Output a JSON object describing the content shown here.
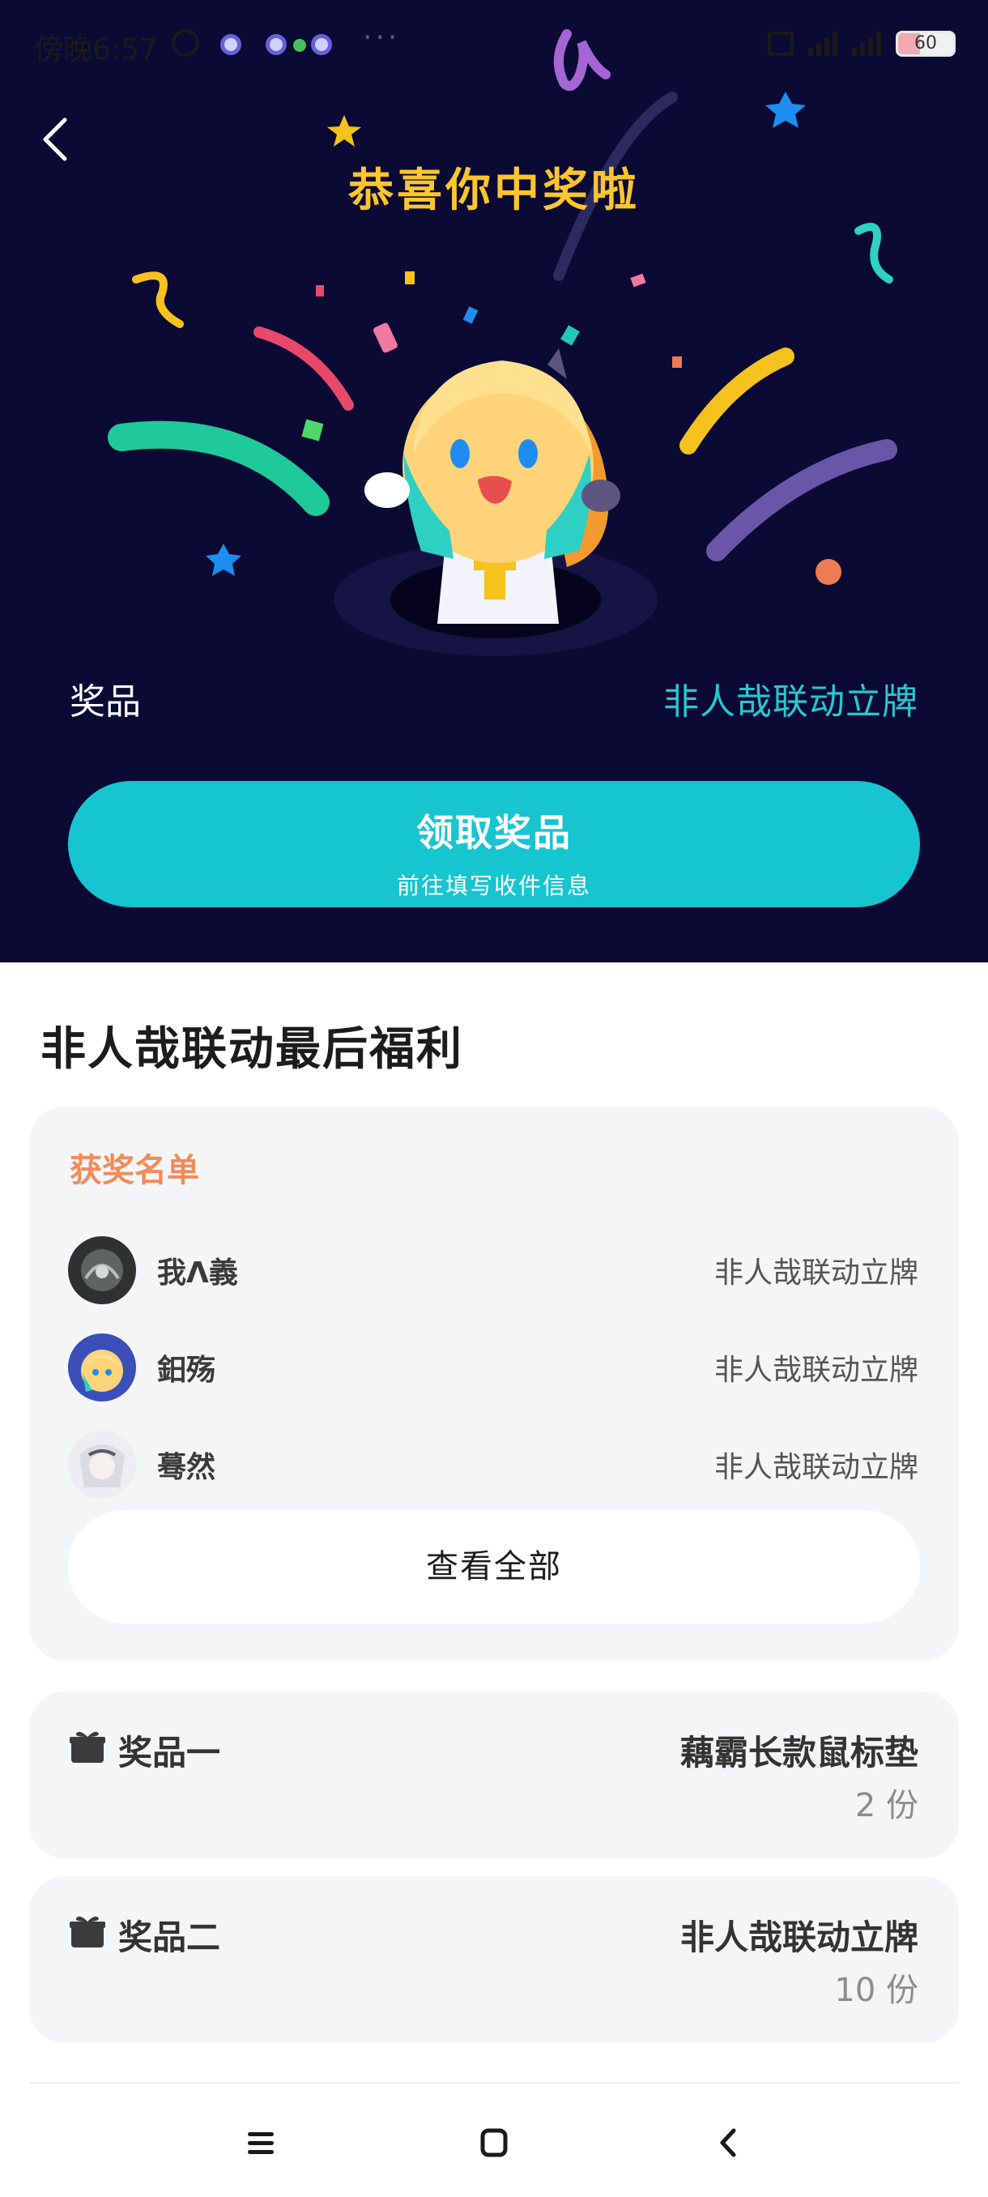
{
  "status_bar": {
    "time": "傍晚6:57",
    "battery": "60"
  },
  "hero": {
    "title": "恭喜你中奖啦",
    "prize_label": "奖品",
    "prize_value": "非人哉联动立牌",
    "claim_button": "领取奖品",
    "claim_subtext": "前往填写收件信息"
  },
  "event": {
    "title": "非人哉联动最后福利"
  },
  "winners": {
    "heading": "获奖名单",
    "list": [
      {
        "name": "我Λ義",
        "prize": "非人哉联动立牌"
      },
      {
        "name": "鈤殇",
        "prize": "非人哉联动立牌"
      },
      {
        "name": "蓦然",
        "prize": "非人哉联动立牌"
      }
    ],
    "view_all": "查看全部"
  },
  "prizes": [
    {
      "label": "奖品一",
      "name": "藕霸长款鼠标垫",
      "count": "2 份"
    },
    {
      "label": "奖品二",
      "name": "非人哉联动立牌",
      "count": "10 份"
    }
  ],
  "icons": {
    "back": "chevron-left-icon",
    "gift": "gift-icon",
    "nav_menu": "menu-icon",
    "nav_home": "home-square-icon",
    "nav_back": "back-icon"
  },
  "colors": {
    "hero_background": "#0b0a35",
    "title_yellow": "#ffc62c",
    "accent_teal": "#16c5cf",
    "winners_heading": "#f08b5a",
    "card_background": "#f4f5f7"
  }
}
